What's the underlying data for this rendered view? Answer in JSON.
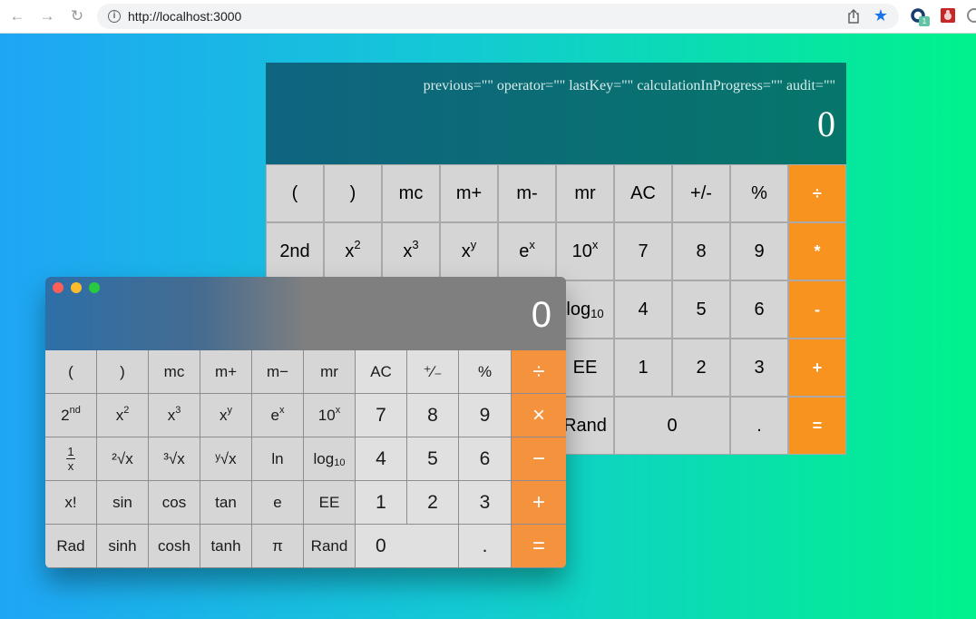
{
  "browser": {
    "url": "http://localhost:3000",
    "back_glyph": "←",
    "forward_glyph": "→",
    "reload_glyph": "↻",
    "info_glyph": "i",
    "star_glyph": "★",
    "extension_badge": "1"
  },
  "big_calc": {
    "state_line": "previous=\"\" operator=\"\" lastKey=\"\" calculationInProgress=\"\" audit=\"\"",
    "display": "0",
    "keys": {
      "open_paren": "(",
      "close_paren": ")",
      "mc": "mc",
      "m_plus": "m+",
      "m_minus": "m-",
      "mr": "mr",
      "ac": "AC",
      "plus_minus": "+/-",
      "percent": "%",
      "divide": "÷",
      "second": "2nd",
      "x_base": "x",
      "sq_exp": "2",
      "cube_exp": "3",
      "pow_exp": "y",
      "e_base": "e",
      "e_exp": "x",
      "ten_base": "10",
      "ten_exp": "x",
      "seven": "7",
      "eight": "8",
      "nine": "9",
      "multiply": "*",
      "log_base": "log",
      "log_sub": "10",
      "four": "4",
      "five": "5",
      "six": "6",
      "minus": "-",
      "ee": "EE",
      "one": "1",
      "two": "2",
      "three": "3",
      "plus": "+",
      "rand": "Rand",
      "zero": "0",
      "dot": ".",
      "equals": "="
    }
  },
  "mac_calc": {
    "display": "0",
    "colors": {
      "close": "#fc5f57",
      "minimize": "#fdbc2e",
      "zoom": "#28c840"
    },
    "keys": {
      "open_paren": "(",
      "close_paren": ")",
      "mc": "mc",
      "m_plus": "m+",
      "m_minus": "m−",
      "mr": "mr",
      "ac": "AC",
      "plus_minus": "⁺∕₋",
      "percent": "%",
      "divide": "÷",
      "second_base": "2",
      "second_sup": "nd",
      "x_base": "x",
      "sq_exp": "2",
      "cube_exp": "3",
      "pow_exp": "y",
      "e_base": "e",
      "e_exp": "x",
      "ten_base": "10",
      "ten_exp": "x",
      "seven": "7",
      "eight": "8",
      "nine": "9",
      "multiply": "×",
      "frac_num": "1",
      "frac_den": "x",
      "sqrt": "²√x",
      "cbrt": "³√x",
      "yroot": "ʸ√x",
      "ln": "ln",
      "log_base": "log",
      "log_sub": "10",
      "four": "4",
      "five": "5",
      "six": "6",
      "minus": "−",
      "factorial": "x!",
      "sin": "sin",
      "cos": "cos",
      "tan": "tan",
      "e": "e",
      "ee": "EE",
      "one": "1",
      "two": "2",
      "three": "3",
      "plus": "+",
      "rad": "Rad",
      "sinh": "sinh",
      "cosh": "cosh",
      "tanh": "tanh",
      "pi": "π",
      "rand": "Rand",
      "zero": "0",
      "dot": ".",
      "equals": "="
    }
  }
}
